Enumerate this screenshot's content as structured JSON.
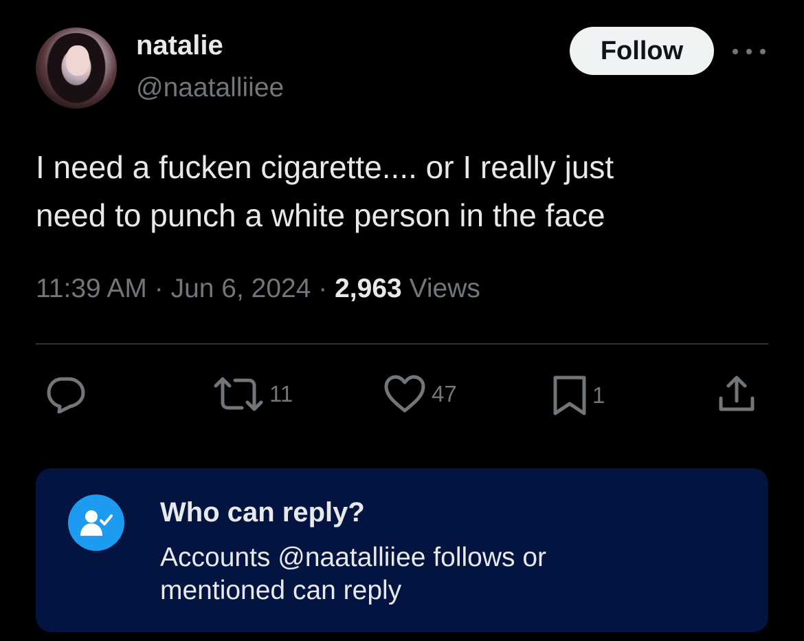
{
  "user": {
    "display_name": "natalie",
    "handle": "@naatalliiee"
  },
  "follow_label": "Follow",
  "tweet": {
    "text_line1": "I need a fucken cigarette.... or I really just",
    "text_line2": "need to punch a white person in the face"
  },
  "meta": {
    "time": "11:39 AM",
    "sep1": "·",
    "date": "Jun 6, 2024",
    "sep2": "·",
    "views_count": "2,963",
    "views_label": "Views"
  },
  "actions": {
    "reply_icon": "reply-icon",
    "retweet_icon": "retweet-icon",
    "retweets": "11",
    "like_icon": "heart-icon",
    "likes": "47",
    "bookmark_icon": "bookmark-icon",
    "bookmarks": "1",
    "share_icon": "share-icon"
  },
  "reply_settings": {
    "icon": "user-check-icon",
    "title": "Who can reply?",
    "desc_line1": "Accounts @naatalliiee follows or",
    "desc_line2": "mentioned can reply"
  },
  "colors": {
    "background": "#000000",
    "text": "#e7e9ea",
    "muted": "#71767b",
    "accent": "#1d9bf0",
    "reply_box_bg": "#031441"
  }
}
